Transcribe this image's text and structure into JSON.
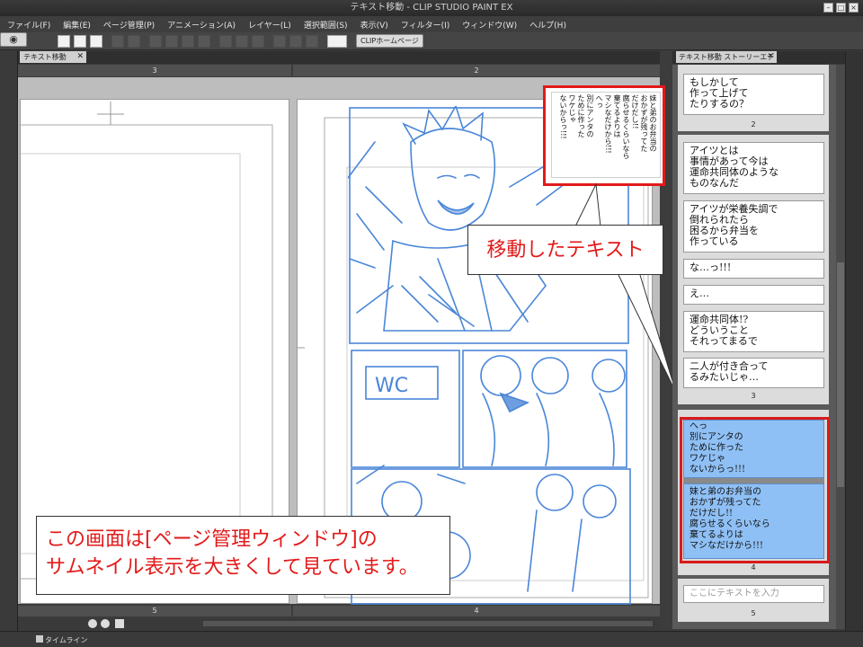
{
  "window": {
    "title": "テキスト移動 - CLIP STUDIO PAINT EX"
  },
  "menu": [
    "ファイル(F)",
    "編集(E)",
    "ページ管理(P)",
    "アニメーション(A)",
    "レイヤー(L)",
    "選択範囲(S)",
    "表示(V)",
    "フィルター(I)",
    "ウィンドウ(W)",
    "ヘルプ(H)"
  ],
  "toolbar": {
    "clip_home": "CLIPホームページ"
  },
  "document": {
    "tab": "テキスト移動",
    "page_headers": [
      "3",
      "2"
    ],
    "page_footers": [
      "5",
      "4"
    ]
  },
  "moved_text": {
    "columns": [
      "妹と弟のお弁当の",
      "おかずが残ってた",
      "だけだし!!",
      "腐らせるくらいなら",
      "棄てるよりは",
      "マシなだけから!!!",
      "へっ",
      "別にアンタの",
      "ために作った",
      "ワケじゃ",
      "ないからっ!!!"
    ]
  },
  "callouts": {
    "moved": "移動したテキスト",
    "note_line1": "この画面は[ページ管理ウィンドウ]の",
    "note_line2": "サムネイル表示を大きくして見ています。"
  },
  "story_editor": {
    "tab": "テキスト移動 ストーリーエディター",
    "page2": {
      "label": "2",
      "texts": [
        "もしかして\n作って上げて\nたりするの？"
      ]
    },
    "page3": {
      "label": "3",
      "texts": [
        "アイツとは\n事情があって今は\n運命共同体のような\nものなんだ",
        "アイツが栄養失調で\n倒れられたら\n困るから弁当を\n作っている",
        "な…っ!!!",
        "え…",
        "運命共同体!?\nどういうこと\nそれってまるで",
        "二人が付き合って\nるみたいじゃ…"
      ]
    },
    "page4": {
      "label": "4",
      "texts": [
        "へっ\n別にアンタの\nために作った\nワケじゃ\nないからっ!!!",
        "妹と弟のお弁当の\nおかずが残ってた\nだけだし!!\n腐らせるくらいなら\n棄てるよりは\nマシなだけから!!!"
      ]
    },
    "page5": {
      "label": "5",
      "placeholder": "ここにテキストを入力"
    }
  },
  "timeline": "タイムライン",
  "colors": {
    "accent_red": "#e21a1a",
    "selection_blue": "#8fc0f5",
    "sketch_blue": "#4a86d8"
  }
}
